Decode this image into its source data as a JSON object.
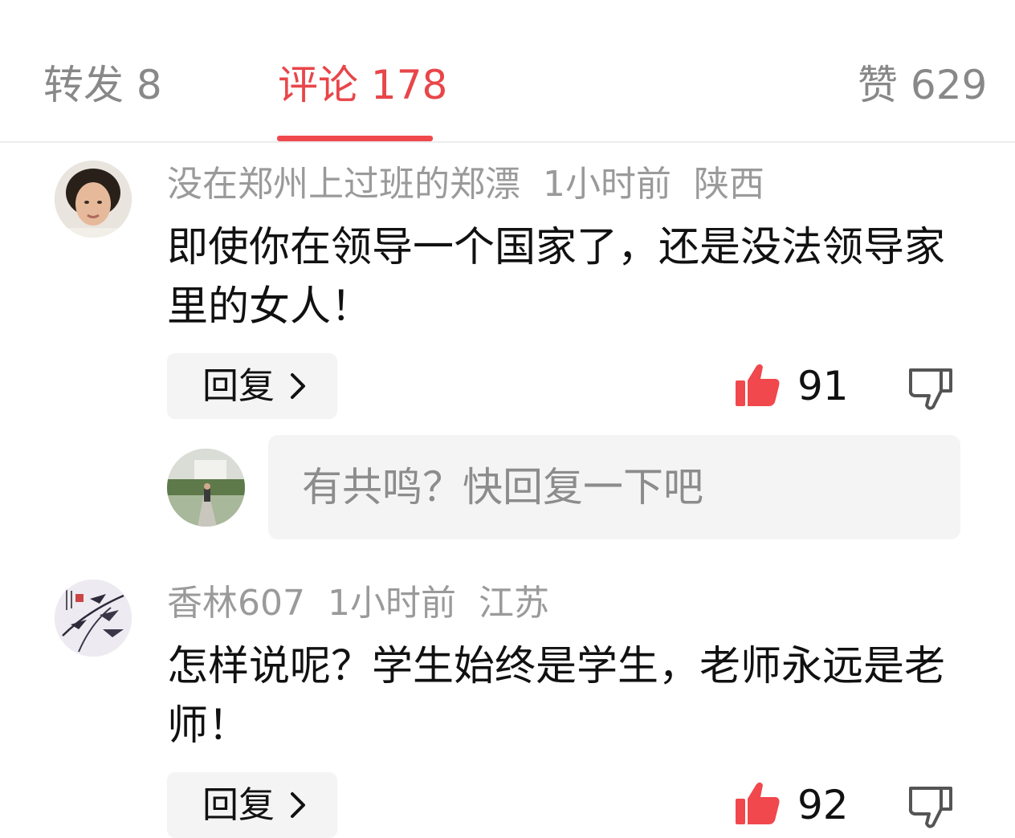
{
  "tabs": [
    {
      "label": "转发 8",
      "active": false
    },
    {
      "label": "评论 178",
      "active": true
    },
    {
      "label": "赞 629",
      "active": false
    }
  ],
  "colors": {
    "accent": "#e8464a",
    "like_red": "#f0484c"
  },
  "comments": [
    {
      "username": "没在郑州上过班的郑漂",
      "time": "1小时前",
      "location": "陕西",
      "text": "即使你在领导一个国家了，还是没法领导家里的女人！",
      "reply_label": "回复",
      "likes": "91"
    },
    {
      "username": "香林607",
      "time": "1小时前",
      "location": "江苏",
      "text": "怎样说呢？学生始终是学生，老师永远是老师！",
      "reply_label": "回复",
      "likes": "92"
    }
  ],
  "reply_box": {
    "placeholder": "有共鸣？快回复一下吧"
  },
  "icons": {
    "like": "thumbs-up-icon",
    "dislike": "thumbs-down-icon",
    "chevron": "chevron-right-icon"
  }
}
